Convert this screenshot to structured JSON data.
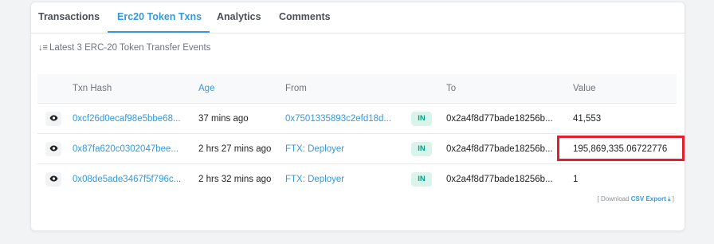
{
  "tabs": [
    "Transactions",
    "Erc20 Token Txns",
    "Analytics",
    "Comments"
  ],
  "summary": "Latest 3 ERC-20 Token Transfer Events",
  "columns": {
    "hash": "Txn Hash",
    "age": "Age",
    "from": "From",
    "to": "To",
    "value": "Value"
  },
  "rows": [
    {
      "hash": "0xcf26d0ecaf98e5bbe68...",
      "age": "37 mins ago",
      "from": "0x7501335893c2efd18d...",
      "badge": "IN",
      "to": "0x2a4f8d77bade18256b...",
      "value": "41,553"
    },
    {
      "hash": "0x87fa620c0302047bee...",
      "age": "2 hrs 27 mins ago",
      "from": "FTX: Deployer",
      "badge": "IN",
      "to": "0x2a4f8d77bade18256b...",
      "value": "195,869,335.06722776"
    },
    {
      "hash": "0x08de5ade3467f5f796c...",
      "age": "2 hrs 32 mins ago",
      "from": "FTX: Deployer",
      "badge": "IN",
      "to": "0x2a4f8d77bade18256b...",
      "value": "1"
    }
  ],
  "footer": {
    "prefix": "[ Download ",
    "link": "CSV Export",
    "suffix": " ]"
  },
  "icons": {
    "sort": "sort-icon",
    "eye": "eye-icon",
    "download": "download-icon"
  },
  "colors": {
    "accent": "#3498db",
    "badge_bg": "#daf4ec",
    "badge_text": "#00a186",
    "highlight": "#e0202e"
  }
}
